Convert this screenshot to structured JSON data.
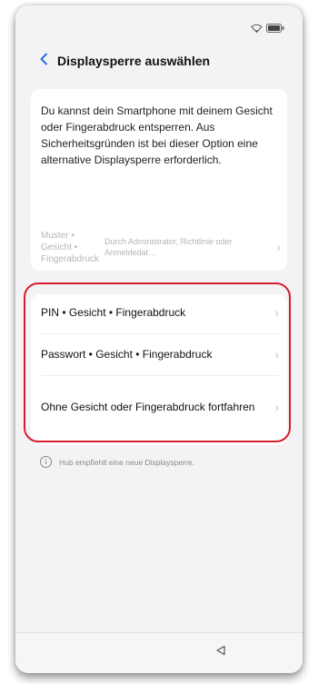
{
  "header": {
    "title": "Displaysperre auswählen",
    "back_icon": "chevron-left-icon"
  },
  "status_bar": {
    "icons": [
      "wifi-icon",
      "battery-icon"
    ]
  },
  "info": {
    "text": "Du kannst dein Smartphone mit deinem Gesicht oder Fingerabdruck entsperren. Aus Sicherheitsgründen ist bei dieser Option eine alternative Displaysperre erforderlich.",
    "disabled_option": {
      "label": "Muster • Gesicht • Fingerabdruck",
      "note": "Durch Administrator, Richtlinie oder Anmeldedat…"
    }
  },
  "options": [
    {
      "label": "PIN • Gesicht • Fingerabdruck"
    },
    {
      "label": "Passwort • Gesicht • Fingerabdruck"
    },
    {
      "label": "Ohne Gesicht oder Fingerabdruck fortfahren"
    }
  ],
  "hint": {
    "icon": "info-icon",
    "text": "Hub empfiehlt eine neue Displaysperre."
  },
  "colors": {
    "accent": "#2f6fe0",
    "highlight": "#d81c2a",
    "background": "#f3f3f6"
  }
}
